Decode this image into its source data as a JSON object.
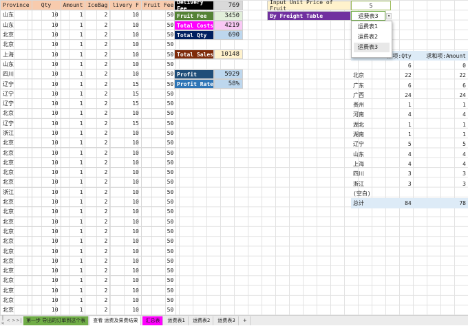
{
  "sheet": {
    "headers": [
      "Province",
      "Qty",
      "Amount",
      "IceBag",
      "livery F",
      "Fruit Fee"
    ],
    "rows": [
      [
        "山东",
        "10",
        "1",
        "2",
        "10",
        "50"
      ],
      [
        "山东",
        "10",
        "1",
        "2",
        "10",
        "50"
      ],
      [
        "北京",
        "10",
        "1",
        "2",
        "10",
        "50"
      ],
      [
        "北京",
        "10",
        "1",
        "2",
        "10",
        "50"
      ],
      [
        "上海",
        "10",
        "1",
        "2",
        "10",
        "50"
      ],
      [
        "山东",
        "10",
        "1",
        "2",
        "10",
        "50"
      ],
      [
        "四川",
        "10",
        "1",
        "2",
        "10",
        "50"
      ],
      [
        "辽宁",
        "10",
        "1",
        "2",
        "15",
        "50"
      ],
      [
        "辽宁",
        "10",
        "1",
        "2",
        "15",
        "50"
      ],
      [
        "辽宁",
        "10",
        "1",
        "2",
        "15",
        "50"
      ],
      [
        "北京",
        "10",
        "1",
        "2",
        "10",
        "50"
      ],
      [
        "辽宁",
        "10",
        "1",
        "2",
        "15",
        "50"
      ],
      [
        "浙江",
        "10",
        "1",
        "2",
        "10",
        "50"
      ],
      [
        "北京",
        "10",
        "1",
        "2",
        "10",
        "50"
      ],
      [
        "北京",
        "10",
        "1",
        "2",
        "10",
        "50"
      ],
      [
        "北京",
        "10",
        "1",
        "2",
        "10",
        "50"
      ],
      [
        "北京",
        "10",
        "1",
        "2",
        "10",
        "50"
      ],
      [
        "北京",
        "10",
        "1",
        "2",
        "10",
        "50"
      ],
      [
        "浙江",
        "10",
        "1",
        "2",
        "10",
        "50"
      ],
      [
        "北京",
        "10",
        "1",
        "2",
        "10",
        "50"
      ],
      [
        "北京",
        "10",
        "1",
        "2",
        "10",
        "50"
      ],
      [
        "北京",
        "10",
        "1",
        "2",
        "10",
        "50"
      ],
      [
        "北京",
        "10",
        "1",
        "2",
        "10",
        "50"
      ],
      [
        "北京",
        "10",
        "1",
        "2",
        "10",
        "50"
      ],
      [
        "北京",
        "10",
        "1",
        "2",
        "10",
        "50"
      ],
      [
        "北京",
        "10",
        "1",
        "2",
        "10",
        "50"
      ],
      [
        "北京",
        "10",
        "1",
        "2",
        "10",
        "50"
      ],
      [
        "北京",
        "10",
        "1",
        "2",
        "10",
        "50"
      ],
      [
        "北京",
        "10",
        "1",
        "2",
        "10",
        "50"
      ],
      [
        "北京",
        "10",
        "1",
        "2",
        "10",
        "50"
      ],
      [
        "北京",
        "10",
        "1",
        "2",
        "10",
        "50"
      ]
    ]
  },
  "summary": {
    "delivery_fee": {
      "label": "Delivery Fee",
      "value": "769"
    },
    "fruit_fee": {
      "label": "Fruit Fee",
      "value": "3450"
    },
    "total_costs": {
      "label": "Total Costs",
      "value": "4219"
    },
    "total_qty": {
      "label": "Total Qty",
      "value": "690"
    },
    "total_sales": {
      "label": "Total Sales",
      "value": "10148"
    },
    "profit": {
      "label": "Profit",
      "value": "5929"
    },
    "profit_rate": {
      "label": "Profit Rate",
      "value": "58%"
    }
  },
  "inputs": {
    "unit_price_label": "Input Unit  Price of Fruit",
    "unit_price_value": "5",
    "freight_label": "By Freight Table",
    "freight_value": "运费表3"
  },
  "dropdown": {
    "options": [
      "运费表1",
      "运费表2",
      "运费表3"
    ]
  },
  "pivot": {
    "headers": [
      "",
      "数项:Qty",
      "求和项:Amount"
    ],
    "rows": [
      [
        "",
        "6",
        "0"
      ],
      [
        "北京",
        "22",
        "22"
      ],
      [
        "广东",
        "6",
        "6"
      ],
      [
        "广西",
        "24",
        "24"
      ],
      [
        "贵州",
        "1",
        "1"
      ],
      [
        "河南",
        "4",
        "4"
      ],
      [
        "湖北",
        "1",
        "1"
      ],
      [
        "湖南",
        "1",
        "1"
      ],
      [
        "辽宁",
        "5",
        "5"
      ],
      [
        "山东",
        "4",
        "4"
      ],
      [
        "上海",
        "4",
        "4"
      ],
      [
        "四川",
        "3",
        "3"
      ],
      [
        "浙江",
        "3",
        "3"
      ],
      [
        "(空白)",
        "",
        ""
      ]
    ],
    "total": [
      "总计",
      "84",
      "78"
    ]
  },
  "tabs": [
    "第一步 导出的订单到这个表",
    "查看 运费及果费结果",
    "汇总表",
    "运费表1",
    "运费表2",
    "运费表3",
    "+"
  ],
  "colors": {
    "header": "#f8cbad",
    "tab1": "#70ad47",
    "tab2": "#d9ead3",
    "tab3": "#ff00ff"
  }
}
